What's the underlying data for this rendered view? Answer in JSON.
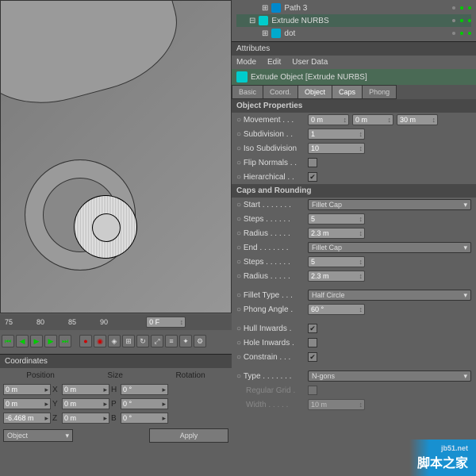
{
  "hierarchy": {
    "items": [
      {
        "label": "Path 3",
        "indent": 2
      },
      {
        "label": "Extrude NURBS",
        "indent": 1,
        "expanded": true
      },
      {
        "label": "dot",
        "indent": 2
      }
    ]
  },
  "attributes_label": "Attributes",
  "menu": {
    "mode": "Mode",
    "edit": "Edit",
    "user_data": "User Data"
  },
  "object_header": "Extrude Object [Extrude NURBS]",
  "tabs": {
    "basic": "Basic",
    "coord": "Coord.",
    "object": "Object",
    "caps": "Caps",
    "phong": "Phong"
  },
  "object_props": {
    "title": "Object Properties",
    "movement_label": "Movement . . .",
    "movement_x": "0 m",
    "movement_y": "0 m",
    "movement_z": "30 m",
    "subdivision_label": "Subdivision . .",
    "subdivision": "1",
    "iso_label": "Iso Subdivision",
    "iso": "10",
    "flip_label": "Flip Normals . .",
    "hierarchical_label": "Hierarchical . .",
    "hierarchical_checked": true
  },
  "caps": {
    "title": "Caps and Rounding",
    "start_label": "Start . . . . . . .",
    "start": "Fillet Cap",
    "steps1_label": "Steps . . . . . .",
    "steps1": "5",
    "radius1_label": "Radius . . . . .",
    "radius1": "2.3 m",
    "end_label": "End . . . . . . .",
    "end": "Fillet Cap",
    "steps2_label": "Steps . . . . . .",
    "steps2": "5",
    "radius2_label": "Radius . . . . .",
    "radius2": "2.3 m",
    "fillet_type_label": "Fillet Type . . .",
    "fillet_type": "Half Circle",
    "phong_label": "Phong Angle .",
    "phong": "60 °",
    "hull_label": "Hull Inwards .",
    "hull_checked": true,
    "hole_label": "Hole Inwards .",
    "constrain_label": "Constrain . . .",
    "constrain_checked": true,
    "type_label": "Type . . . . . . .",
    "type": "N-gons",
    "regular_label": "Regular Grid .",
    "width_label": "Width . . . . .",
    "width": "10 m"
  },
  "timeline": {
    "ticks": [
      "75",
      "80",
      "85",
      "90"
    ],
    "frame": "0 F"
  },
  "coords": {
    "title": "Coordinates",
    "headers": {
      "pos": "Position",
      "size": "Size",
      "rot": "Rotation"
    },
    "x": {
      "pos": "0 m",
      "size": "0 m",
      "rot": "0 °"
    },
    "y": {
      "pos": "0 m",
      "size": "0 m",
      "rot": "0 °"
    },
    "z": {
      "pos": "-6.468 m",
      "size": "0 m",
      "rot": "0 °"
    },
    "mode": "Object",
    "apply": "Apply"
  },
  "watermark": {
    "url": "jb51.net",
    "text": "脚本之家"
  }
}
